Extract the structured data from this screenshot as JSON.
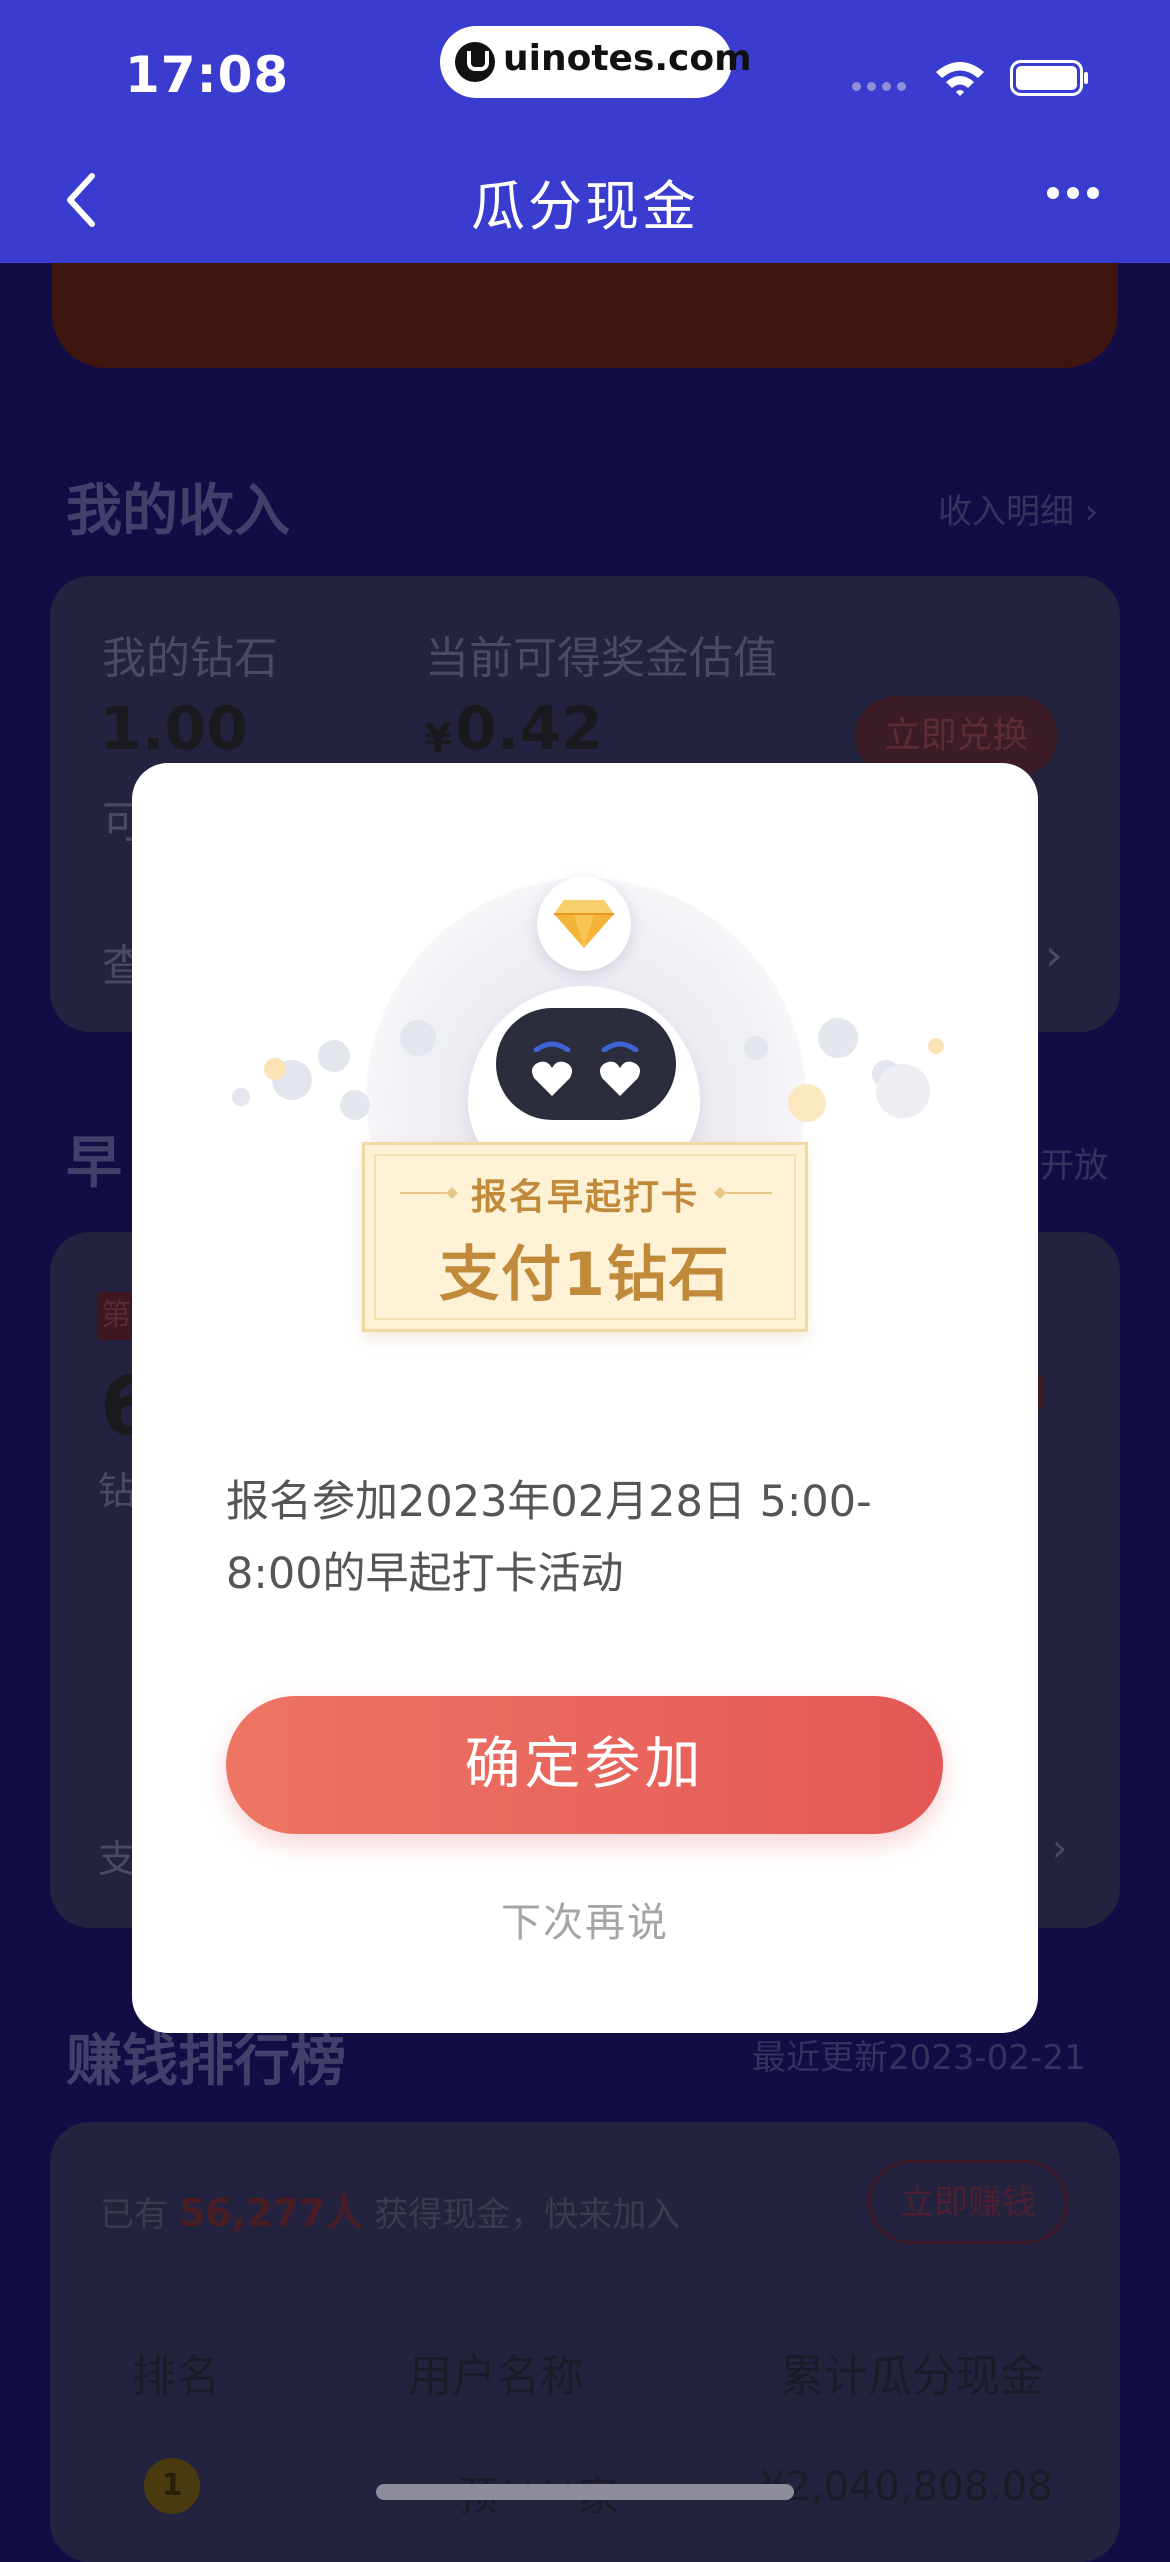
{
  "status_bar": {
    "time": "17:08",
    "url": "uinotes.com"
  },
  "nav": {
    "title": "瓜分现金"
  },
  "income": {
    "title": "我的收入",
    "link": "收入明细 ›",
    "diamond_label": "我的钻石",
    "diamond_value": "1.00",
    "available_fragment": "可",
    "estimate_label": "当前可得奖金估值",
    "estimate_currency": "¥",
    "estimate_value": "0.42",
    "exchange_button": "立即兑换",
    "view_fragment": "查",
    "chevron": "›"
  },
  "early": {
    "title_fragment": "早",
    "open_fragment": "开放",
    "badge_fragment": "第",
    "number_fragment": "6",
    "unit_fragment": "钻",
    "bottom_fragment": "支",
    "right_arrow": "›"
  },
  "ranking": {
    "title": "赚钱排行榜",
    "updated": "最近更新2023-02-21",
    "count_prefix": "已有",
    "count": "56,277人",
    "count_suffix": "获得现金，快来加入",
    "earn_button": "立即赚钱",
    "col_rank": "排名",
    "col_user": "用户名称",
    "col_amount": "累计瓜分现金",
    "row1_rank": "1",
    "row1_user": "预****家",
    "row1_amount": "¥2,040,808.08"
  },
  "modal": {
    "plaque_subtitle": "报名早起打卡",
    "plaque_title": "支付1钻石",
    "description": "报名参加2023年02月28日 5:00-8:00的早起打卡活动",
    "confirm_button": "确定参加",
    "later_link": "下次再说"
  },
  "colors": {
    "nav_bg": "#3a3ccf",
    "overlay_bg": "#120d45",
    "confirm_start": "#ee7564",
    "confirm_end": "#e35856",
    "plaque_text": "#c08a3a"
  }
}
